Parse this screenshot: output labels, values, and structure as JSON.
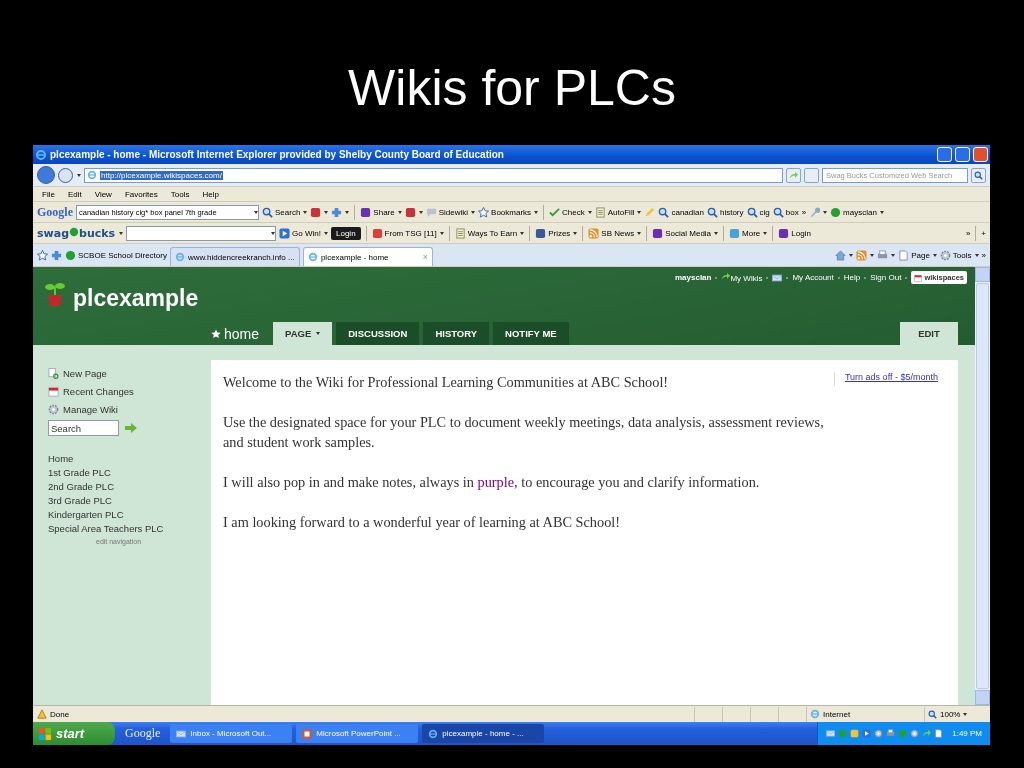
{
  "slide": {
    "title": "Wikis for PLCs"
  },
  "window": {
    "title": "plcexample - home - Microsoft Internet Explorer provided by Shelby County Board of Education"
  },
  "address_bar": {
    "url": "http://plcexample.wikispaces.com/",
    "search_placeholder": "Swag Bucks Customized Web Search"
  },
  "menu": [
    "File",
    "Edit",
    "View",
    "Favorites",
    "Tools",
    "Help"
  ],
  "google_toolbar": {
    "brand": "Google",
    "query": "canadian history cig* box panel 7th grade",
    "groups": [
      [
        {
          "kind": "mag",
          "label": "Search",
          "menu": true
        },
        {
          "kind": "square",
          "menu": true
        },
        {
          "kind": "plus",
          "menu": true
        }
      ],
      [
        {
          "kind": "square",
          "label": "Share",
          "menu": true
        },
        {
          "kind": "square",
          "menu": true
        },
        {
          "kind": "bubble",
          "label": "Sidewiki",
          "menu": true
        },
        {
          "kind": "star",
          "label": "Bookmarks",
          "menu": true
        }
      ],
      [
        {
          "kind": "check",
          "label": "Check",
          "menu": true
        },
        {
          "kind": "doc",
          "label": "AutoFill",
          "menu": true
        },
        {
          "kind": "pencil"
        },
        {
          "kind": "mag",
          "label": "canadian"
        },
        {
          "kind": "mag",
          "label": "history"
        },
        {
          "kind": "mag",
          "label": "cig"
        },
        {
          "kind": "mag",
          "label": "box"
        },
        {
          "kind": "text",
          "label": "»"
        },
        {
          "kind": "wrench",
          "menu": true
        },
        {
          "kind": "dot",
          "label": "maysclan",
          "menu": true
        }
      ]
    ]
  },
  "swag_toolbar": {
    "brand_left": "swag",
    "brand_right": "bucks",
    "groups": [
      [
        {
          "kind": "play",
          "label": "Go Win!",
          "menu": true
        },
        {
          "kind": "dark",
          "label": "Login"
        }
      ],
      [
        {
          "kind": "square",
          "label": "From TSG  [11]",
          "menu": true
        }
      ],
      [
        {
          "kind": "doc",
          "label": "Ways To Earn",
          "menu": true
        }
      ],
      [
        {
          "kind": "square",
          "label": "Prizes",
          "menu": true
        }
      ],
      [
        {
          "kind": "rss",
          "label": "SB News",
          "menu": true
        }
      ],
      [
        {
          "kind": "square",
          "label": "Social Media",
          "menu": true
        }
      ],
      [
        {
          "kind": "square",
          "label": "More",
          "menu": true
        }
      ],
      [
        {
          "kind": "square",
          "label": "Login"
        }
      ]
    ],
    "more": "»",
    "add": "+"
  },
  "tab_bar": {
    "favorite": "SCBOE School Directory",
    "tabs": [
      {
        "label": "www.hiddencreekranch.info ...",
        "selected": false
      },
      {
        "label": "plcexample - home",
        "selected": true
      }
    ],
    "close": "×",
    "commands": [
      {
        "kind": "home",
        "menu": true
      },
      {
        "kind": "rss",
        "menu": true
      },
      {
        "kind": "printer",
        "menu": true
      },
      {
        "kind": "page",
        "label": "Page",
        "menu": true
      },
      {
        "kind": "gear",
        "label": "Tools",
        "menu": true
      }
    ],
    "more": "»"
  },
  "wiki": {
    "site": "plcexample",
    "user_links": [
      {
        "kind": "text",
        "label": "maysclan"
      },
      {
        "kind": "arrow",
        "label": "My Wikis"
      },
      {
        "kind": "mail"
      },
      {
        "kind": "text",
        "label": "My Account"
      },
      {
        "kind": "text",
        "label": "Help"
      },
      {
        "kind": "text",
        "label": "Sign Out"
      }
    ],
    "badge": "wikispaces",
    "home": "home",
    "tabs": [
      {
        "label": "PAGE",
        "selected": true,
        "menu": true
      },
      {
        "label": "DISCUSSION",
        "selected": false
      },
      {
        "label": "HISTORY",
        "selected": false
      },
      {
        "label": "NOTIFY ME",
        "selected": false
      }
    ],
    "edit": "EDIT",
    "actions": [
      {
        "kind": "new",
        "label": "New Page"
      },
      {
        "kind": "calendar",
        "label": "Recent Changes"
      },
      {
        "kind": "gear",
        "label": "Manage Wiki"
      }
    ],
    "search_placeholder": "Search",
    "navigation": [
      "Home",
      "1st Grade PLC",
      "2nd Grade PLC",
      "3rd Grade PLC",
      "Kindergarten PLC",
      "Special Area Teachers PLC"
    ],
    "edit_navigation": "edit navigation",
    "paragraphs": [
      {
        "text": "Welcome to the Wiki for Professional Learning Communities at ABC School!"
      },
      {
        "text": "Use the designated space for your PLC to document weekly meetings, data analysis, assessment reviews, and student work samples."
      },
      {
        "text": "I will also pop in and make notes, always in ",
        "highlight": "purple",
        "after": ", to encourage you and clarify information."
      },
      {
        "text": "I am looking forward to a wonderful year of learning at ABC School!"
      }
    ],
    "ad_link": "Turn ads off - $5/month"
  },
  "status_bar": {
    "status": "Done",
    "zone": "Internet",
    "zoom": "100%"
  },
  "taskbar": {
    "start": "start",
    "quick": "Google",
    "tasks": [
      {
        "kind": "mail",
        "label": "Inbox - Microsoft Out...",
        "selected": false
      },
      {
        "kind": "slides",
        "label": "Microsoft PowerPoint ...",
        "selected": false
      },
      {
        "kind": "browser",
        "label": "plcexample - home - ...",
        "selected": true
      }
    ],
    "clock": "1:49 PM"
  }
}
